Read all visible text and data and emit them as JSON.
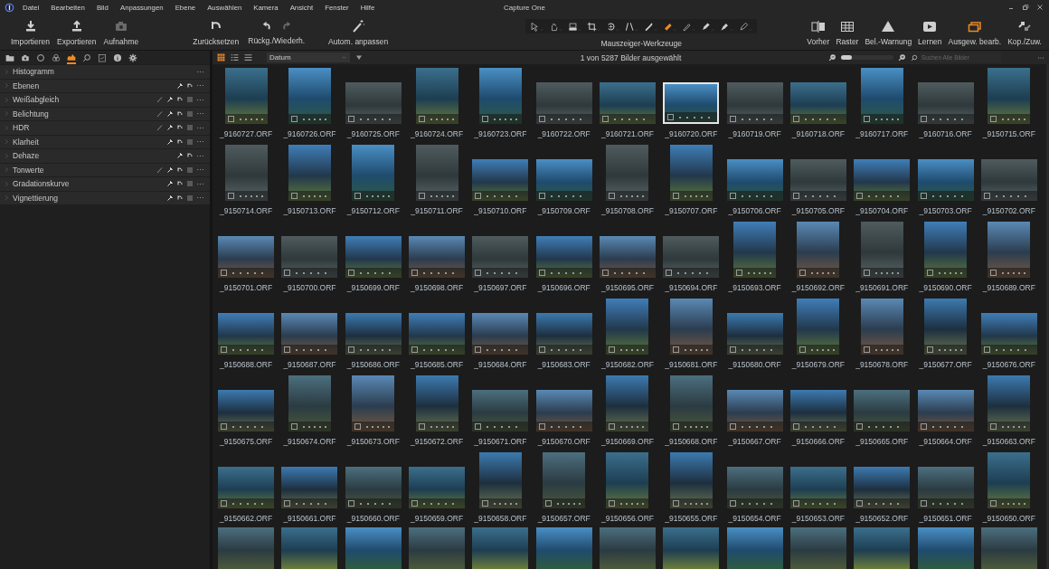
{
  "window": {
    "title": "Capture One"
  },
  "menu": [
    "Datei",
    "Bearbeiten",
    "Bild",
    "Anpassungen",
    "Ebene",
    "Auswählen",
    "Kamera",
    "Ansicht",
    "Fenster",
    "Hilfe"
  ],
  "toolbar_left": [
    {
      "label": "Importieren",
      "kind": "import",
      "disabled": false
    },
    {
      "label": "Exportieren",
      "kind": "export",
      "disabled": false
    },
    {
      "label": "Aufnahme",
      "kind": "camera",
      "disabled": true
    }
  ],
  "toolbar_mid": [
    {
      "label": "Zurücksetzen",
      "kind": "reset"
    },
    {
      "label": "Rückg./Wiederh.",
      "kind": "undo"
    },
    {
      "label": "Autom. anpassen",
      "kind": "wand"
    }
  ],
  "cursor_tools": {
    "label": "Mauszeiger-Werkzeuge",
    "tools": [
      {
        "kind": "select",
        "selected": false
      },
      {
        "kind": "pan",
        "selected": false
      },
      {
        "kind": "loupe",
        "selected": false
      },
      {
        "kind": "crop",
        "selected": false
      },
      {
        "kind": "rotate",
        "selected": false
      },
      {
        "kind": "keystone",
        "selected": false
      },
      {
        "kind": "picker",
        "selected": false
      },
      {
        "kind": "heal",
        "selected": true
      },
      {
        "kind": "erase",
        "selected": false
      },
      {
        "kind": "pen",
        "selected": false
      },
      {
        "kind": "fill",
        "selected": false
      },
      {
        "kind": "gradient",
        "selected": false
      }
    ]
  },
  "toolbar_right": [
    {
      "label": "Vorher",
      "kind": "compare",
      "on": false
    },
    {
      "label": "Raster",
      "kind": "grid",
      "on": false
    },
    {
      "label": "Bel.-Warnung",
      "kind": "warning",
      "on": false
    },
    {
      "label": "Lernen",
      "kind": "play",
      "on": false
    },
    {
      "label": "Ausgew. bearb.",
      "kind": "stack",
      "on": true
    },
    {
      "label": "Kop./Zuw.",
      "kind": "copyapply",
      "on": false
    }
  ],
  "sidebar": {
    "tabs": [
      {
        "kind": "folder",
        "selected": false
      },
      {
        "kind": "camera",
        "selected": false
      },
      {
        "kind": "circle",
        "selected": false
      },
      {
        "kind": "color",
        "selected": false
      },
      {
        "kind": "exposure",
        "selected": true
      },
      {
        "kind": "search",
        "selected": false
      },
      {
        "kind": "clipboard",
        "selected": false
      },
      {
        "kind": "info",
        "selected": false
      },
      {
        "kind": "gear",
        "selected": false
      }
    ],
    "tools": [
      {
        "label": "Histogramm",
        "brush": false,
        "copy": false,
        "presets": false
      },
      {
        "label": "Ebenen",
        "brush": false,
        "copy": true,
        "presets": false
      },
      {
        "label": "Weißabgleich",
        "brush": true,
        "copy": true,
        "presets": true
      },
      {
        "label": "Belichtung",
        "brush": true,
        "copy": true,
        "presets": true
      },
      {
        "label": "HDR",
        "brush": true,
        "copy": true,
        "presets": true
      },
      {
        "label": "Klarheit",
        "brush": false,
        "copy": true,
        "presets": true
      },
      {
        "label": "Dehaze",
        "brush": false,
        "copy": true,
        "presets": false
      },
      {
        "label": "Tonwerte",
        "brush": true,
        "copy": true,
        "presets": true
      },
      {
        "label": "Gradationskurve",
        "brush": false,
        "copy": true,
        "presets": true
      },
      {
        "label": "Vignettierung",
        "brush": false,
        "copy": true,
        "presets": true
      }
    ]
  },
  "browser": {
    "views": [
      {
        "kind": "grid",
        "selected": true
      },
      {
        "kind": "list",
        "selected": false
      },
      {
        "kind": "filmstrip",
        "selected": false
      }
    ],
    "sort": "Datum",
    "status": "1 von 5287 Bilder ausgewählt",
    "zoom": {
      "level": 0.2
    },
    "search": {
      "placeholder": "Suchen Alle Bilder"
    },
    "thumbnails": [
      {
        "name": "_9160727.ORF",
        "kind": "portrait",
        "selected": false
      },
      {
        "name": "_9160726.ORF",
        "kind": "portrait",
        "selected": false
      },
      {
        "name": "_9160725.ORF",
        "kind": "landscape",
        "selected": false
      },
      {
        "name": "_9160724.ORF",
        "kind": "portrait",
        "selected": false
      },
      {
        "name": "_9160723.ORF",
        "kind": "portrait",
        "selected": false
      },
      {
        "name": "_9160722.ORF",
        "kind": "landscape",
        "selected": false
      },
      {
        "name": "_9160721.ORF",
        "kind": "landscape",
        "selected": false
      },
      {
        "name": "_9160720.ORF",
        "kind": "landscape",
        "selected": true
      },
      {
        "name": "_9160719.ORF",
        "kind": "landscape",
        "selected": false
      },
      {
        "name": "_9160718.ORF",
        "kind": "landscape",
        "selected": false
      },
      {
        "name": "_9160717.ORF",
        "kind": "portrait",
        "selected": false
      },
      {
        "name": "_9160716.ORF",
        "kind": "landscape",
        "selected": false
      },
      {
        "name": "_9150715.ORF",
        "kind": "portrait",
        "selected": false
      },
      {
        "name": "_9150714.ORF",
        "kind": "portrait",
        "selected": false
      },
      {
        "name": "_9150713.ORF",
        "kind": "portrait",
        "selected": false
      },
      {
        "name": "_9150712.ORF",
        "kind": "portrait",
        "selected": false
      },
      {
        "name": "_9150711.ORF",
        "kind": "portrait",
        "selected": false
      },
      {
        "name": "_9150710.ORF",
        "kind": "landscape",
        "selected": false
      },
      {
        "name": "_9150709.ORF",
        "kind": "landscape",
        "selected": false
      },
      {
        "name": "_9150708.ORF",
        "kind": "portrait",
        "selected": false
      },
      {
        "name": "_9150707.ORF",
        "kind": "portrait",
        "selected": false
      },
      {
        "name": "_9150706.ORF",
        "kind": "landscape",
        "selected": false
      },
      {
        "name": "_9150705.ORF",
        "kind": "landscape",
        "selected": false
      },
      {
        "name": "_9150704.ORF",
        "kind": "landscape",
        "selected": false
      },
      {
        "name": "_9150703.ORF",
        "kind": "landscape",
        "selected": false
      },
      {
        "name": "_9150702.ORF",
        "kind": "landscape",
        "selected": false
      },
      {
        "name": "_9150701.ORF",
        "kind": "landscape",
        "selected": false
      },
      {
        "name": "_9150700.ORF",
        "kind": "landscape",
        "selected": false
      },
      {
        "name": "_9150699.ORF",
        "kind": "landscape",
        "selected": false
      },
      {
        "name": "_9150698.ORF",
        "kind": "landscape",
        "selected": false
      },
      {
        "name": "_9150697.ORF",
        "kind": "landscape",
        "selected": false
      },
      {
        "name": "_9150696.ORF",
        "kind": "landscape",
        "selected": false
      },
      {
        "name": "_9150695.ORF",
        "kind": "landscape",
        "selected": false
      },
      {
        "name": "_9150694.ORF",
        "kind": "landscape",
        "selected": false
      },
      {
        "name": "_9150693.ORF",
        "kind": "portrait",
        "selected": false
      },
      {
        "name": "_9150692.ORF",
        "kind": "portrait",
        "selected": false
      },
      {
        "name": "_9150691.ORF",
        "kind": "portrait",
        "selected": false
      },
      {
        "name": "_9150690.ORF",
        "kind": "portrait",
        "selected": false
      },
      {
        "name": "_9150689.ORF",
        "kind": "portrait",
        "selected": false
      },
      {
        "name": "_9150688.ORF",
        "kind": "landscape",
        "selected": false
      },
      {
        "name": "_9150687.ORF",
        "kind": "landscape",
        "selected": false
      },
      {
        "name": "_9150686.ORF",
        "kind": "landscape",
        "selected": false
      },
      {
        "name": "_9150685.ORF",
        "kind": "landscape",
        "selected": false
      },
      {
        "name": "_9150684.ORF",
        "kind": "landscape",
        "selected": false
      },
      {
        "name": "_9150683.ORF",
        "kind": "landscape",
        "selected": false
      },
      {
        "name": "_9150682.ORF",
        "kind": "portrait",
        "selected": false
      },
      {
        "name": "_9150681.ORF",
        "kind": "portrait",
        "selected": false
      },
      {
        "name": "_9150680.ORF",
        "kind": "landscape",
        "selected": false
      },
      {
        "name": "_9150679.ORF",
        "kind": "portrait",
        "selected": false
      },
      {
        "name": "_9150678.ORF",
        "kind": "portrait",
        "selected": false
      },
      {
        "name": "_9150677.ORF",
        "kind": "portrait",
        "selected": false
      },
      {
        "name": "_9150676.ORF",
        "kind": "landscape",
        "selected": false
      },
      {
        "name": "_9150675.ORF",
        "kind": "landscape",
        "selected": false
      },
      {
        "name": "_9150674.ORF",
        "kind": "portrait",
        "selected": false
      },
      {
        "name": "_9150673.ORF",
        "kind": "portrait",
        "selected": false
      },
      {
        "name": "_9150672.ORF",
        "kind": "portrait",
        "selected": false
      },
      {
        "name": "_9150671.ORF",
        "kind": "landscape",
        "selected": false
      },
      {
        "name": "_9150670.ORF",
        "kind": "landscape",
        "selected": false
      },
      {
        "name": "_9150669.ORF",
        "kind": "portrait",
        "selected": false
      },
      {
        "name": "_9150668.ORF",
        "kind": "portrait",
        "selected": false
      },
      {
        "name": "_9150667.ORF",
        "kind": "landscape",
        "selected": false
      },
      {
        "name": "_9150666.ORF",
        "kind": "landscape",
        "selected": false
      },
      {
        "name": "_9150665.ORF",
        "kind": "landscape",
        "selected": false
      },
      {
        "name": "_9150664.ORF",
        "kind": "landscape",
        "selected": false
      },
      {
        "name": "_9150663.ORF",
        "kind": "portrait",
        "selected": false
      },
      {
        "name": "_9150662.ORF",
        "kind": "landscape",
        "selected": false
      },
      {
        "name": "_9150661.ORF",
        "kind": "landscape",
        "selected": false
      },
      {
        "name": "_9150660.ORF",
        "kind": "landscape",
        "selected": false
      },
      {
        "name": "_9150659.ORF",
        "kind": "landscape",
        "selected": false
      },
      {
        "name": "_9150658.ORF",
        "kind": "portrait",
        "selected": false
      },
      {
        "name": "_9150657.ORF",
        "kind": "portrait",
        "selected": false
      },
      {
        "name": "_9150656.ORF",
        "kind": "portrait",
        "selected": false
      },
      {
        "name": "_9150655.ORF",
        "kind": "portrait",
        "selected": false
      },
      {
        "name": "_9150654.ORF",
        "kind": "landscape",
        "selected": false
      },
      {
        "name": "_9150653.ORF",
        "kind": "landscape",
        "selected": false
      },
      {
        "name": "_9150652.ORF",
        "kind": "landscape",
        "selected": false
      },
      {
        "name": "_9150651.ORF",
        "kind": "landscape",
        "selected": false
      },
      {
        "name": "_9150650.ORF",
        "kind": "portrait",
        "selected": false
      }
    ],
    "partial_row": [
      {
        "kind": "landscape"
      },
      {
        "kind": "landscape"
      },
      {
        "kind": "landscape"
      },
      {
        "kind": "landscape"
      },
      {
        "kind": "landscape"
      },
      {
        "kind": "landscape"
      },
      {
        "kind": "landscape"
      },
      {
        "kind": "landscape"
      },
      {
        "kind": "landscape"
      },
      {
        "kind": "landscape"
      },
      {
        "kind": "landscape"
      },
      {
        "kind": "landscape"
      },
      {
        "kind": "landscape"
      }
    ]
  }
}
